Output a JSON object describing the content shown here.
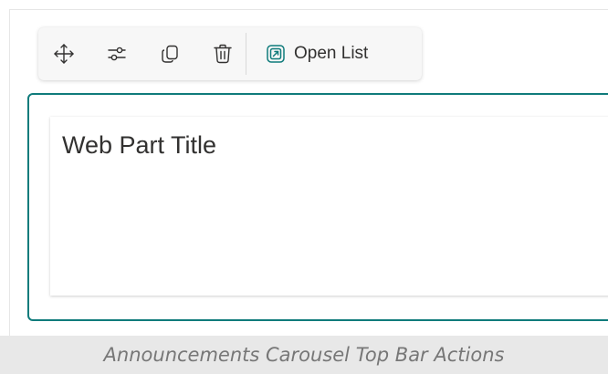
{
  "toolbar": {
    "actions": [
      {
        "name": "move",
        "icon": "move-icon"
      },
      {
        "name": "edit-properties",
        "icon": "sliders-icon"
      },
      {
        "name": "duplicate",
        "icon": "duplicate-icon"
      },
      {
        "name": "delete",
        "icon": "trash-icon"
      }
    ],
    "open_list": {
      "icon": "open-external-icon",
      "label": "Open List"
    }
  },
  "webpart": {
    "title": "Web Part Title",
    "accent_color": "#0f7b7b"
  },
  "caption": "Announcements Carousel Top Bar Actions"
}
